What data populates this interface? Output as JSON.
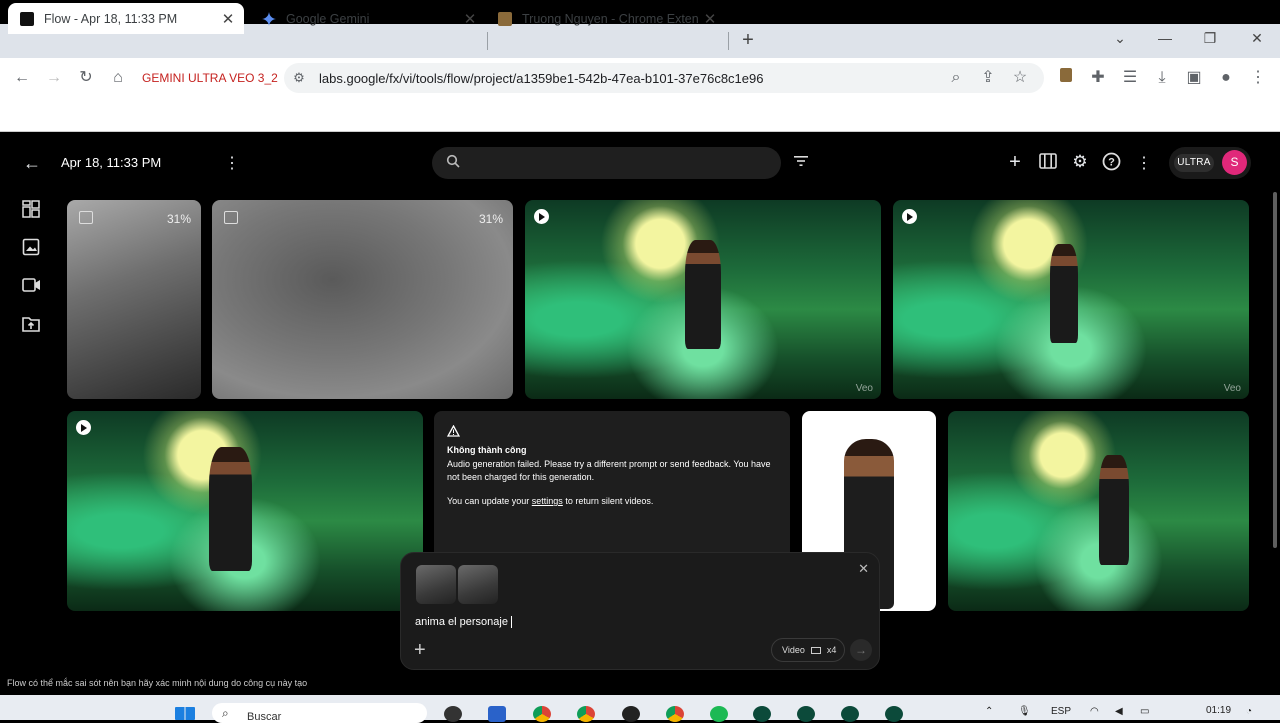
{
  "browser": {
    "tabs": [
      {
        "title": "Flow - Apr 18, 11:33 PM",
        "active": true
      },
      {
        "title": "Google Gemini",
        "active": false
      },
      {
        "title": "Truong Nguyen - Chrome Exten",
        "active": false
      }
    ],
    "profile_label": "GEMINI ULTRA VEO 3_2",
    "url": "labs.google/fx/vi/tools/flow/project/a1359be1-542b-47ea-b101-37e76c8c1e96"
  },
  "app": {
    "title": "Apr 18, 11:33 PM",
    "ultra_label": "ULTRA",
    "avatar_letter": "S",
    "sidebar": [
      "grid-view",
      "images",
      "videos",
      "upload"
    ],
    "tiles": {
      "loading_1": {
        "percent": "31%",
        "progress": 0.31
      },
      "loading_2": {
        "percent": "31%",
        "progress": 0.31
      },
      "veo_label": "Veo"
    },
    "error": {
      "title": "Không thành công",
      "message": "Audio generation failed. Please try a different prompt or send feedback. You have not been charged for this generation.",
      "settings_prefix": "You can update your",
      "settings_link": "settings",
      "settings_suffix": "to return silent videos."
    },
    "prompt": {
      "text": "anima el personaje",
      "mode": "Video",
      "count": "x4"
    },
    "disclaimer": "Flow có thể mắc sai sót nên bạn hãy xác minh nội dung do công cụ này tạo"
  },
  "taskbar": {
    "search_placeholder": "Buscar",
    "language": "ESP",
    "time": "01:19"
  },
  "colors": {
    "avatar": "#e0287a",
    "profile_label": "#c5221f"
  }
}
